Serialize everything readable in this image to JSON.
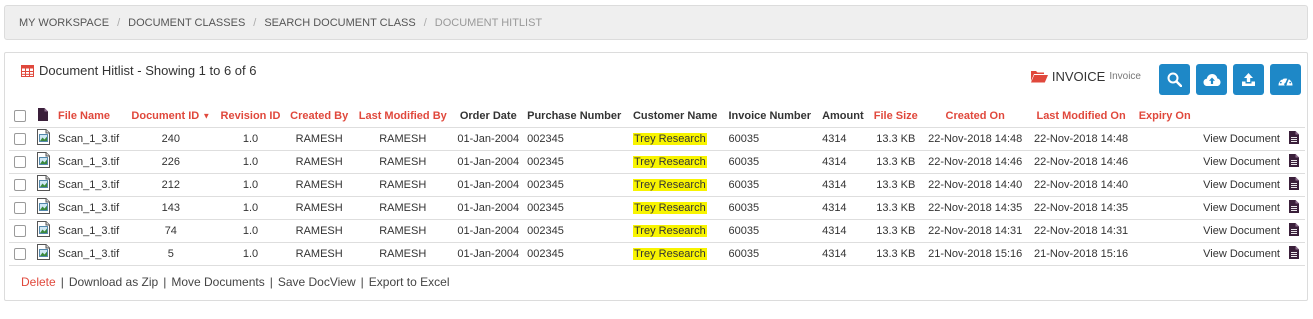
{
  "breadcrumb": [
    "MY WORKSPACE",
    "DOCUMENT CLASSES",
    "SEARCH DOCUMENT CLASS",
    "DOCUMENT HITLIST"
  ],
  "panel": {
    "title": "Document Hitlist - Showing 1 to 6 of 6",
    "title_icon": "table-icon",
    "doc_class": "INVOICE",
    "doc_class_sub": "Invoice",
    "doc_class_icon": "folder-open-icon",
    "toolbar_icons": [
      "search-icon",
      "cloud-upload-icon",
      "upload-icon",
      "dashboard-icon"
    ]
  },
  "columns": [
    "File Name",
    "Document ID",
    "Revision ID",
    "Created By",
    "Last Modified By",
    "Order Date",
    "Purchase Number",
    "Customer Name",
    "Invoice Number",
    "Amount",
    "File Size",
    "Created On",
    "Last Modified On",
    "Expiry On"
  ],
  "sortable_columns": [
    "File Name",
    "Document ID",
    "Revision ID",
    "Created By",
    "Last Modified By",
    "File Size",
    "Created On",
    "Last Modified On",
    "Expiry On"
  ],
  "sorted_column": "Document ID",
  "rows": [
    {
      "file": "Scan_1_3.tif",
      "doc_id": "240",
      "rev": "1.0",
      "created_by": "RAMESH",
      "modified_by": "RAMESH",
      "order_date": "01-Jan-2004",
      "purchase": "002345",
      "customer": "Trey Research",
      "invoice": "60035",
      "amount": "4314",
      "size": "13.3 KB",
      "created_on": "22-Nov-2018 14:48",
      "modified_on": "22-Nov-2018 14:48",
      "expiry": "",
      "action": "View Document"
    },
    {
      "file": "Scan_1_3.tif",
      "doc_id": "226",
      "rev": "1.0",
      "created_by": "RAMESH",
      "modified_by": "RAMESH",
      "order_date": "01-Jan-2004",
      "purchase": "002345",
      "customer": "Trey Research",
      "invoice": "60035",
      "amount": "4314",
      "size": "13.3 KB",
      "created_on": "22-Nov-2018 14:46",
      "modified_on": "22-Nov-2018 14:46",
      "expiry": "",
      "action": "View Document"
    },
    {
      "file": "Scan_1_3.tif",
      "doc_id": "212",
      "rev": "1.0",
      "created_by": "RAMESH",
      "modified_by": "RAMESH",
      "order_date": "01-Jan-2004",
      "purchase": "002345",
      "customer": "Trey Research",
      "invoice": "60035",
      "amount": "4314",
      "size": "13.3 KB",
      "created_on": "22-Nov-2018 14:40",
      "modified_on": "22-Nov-2018 14:40",
      "expiry": "",
      "action": "View Document"
    },
    {
      "file": "Scan_1_3.tif",
      "doc_id": "143",
      "rev": "1.0",
      "created_by": "RAMESH",
      "modified_by": "RAMESH",
      "order_date": "01-Jan-2004",
      "purchase": "002345",
      "customer": "Trey Research",
      "invoice": "60035",
      "amount": "4314",
      "size": "13.3 KB",
      "created_on": "22-Nov-2018 14:35",
      "modified_on": "22-Nov-2018 14:35",
      "expiry": "",
      "action": "View Document"
    },
    {
      "file": "Scan_1_3.tif",
      "doc_id": "74",
      "rev": "1.0",
      "created_by": "RAMESH",
      "modified_by": "RAMESH",
      "order_date": "01-Jan-2004",
      "purchase": "002345",
      "customer": "Trey Research",
      "invoice": "60035",
      "amount": "4314",
      "size": "13.3 KB",
      "created_on": "22-Nov-2018 14:31",
      "modified_on": "22-Nov-2018 14:31",
      "expiry": "",
      "action": "View Document"
    },
    {
      "file": "Scan_1_3.tif",
      "doc_id": "5",
      "rev": "1.0",
      "created_by": "RAMESH",
      "modified_by": "RAMESH",
      "order_date": "01-Jan-2004",
      "purchase": "002345",
      "customer": "Trey Research",
      "invoice": "60035",
      "amount": "4314",
      "size": "13.3 KB",
      "created_on": "21-Nov-2018 15:16",
      "modified_on": "21-Nov-2018 15:16",
      "expiry": "",
      "action": "View Document"
    }
  ],
  "footer_actions": [
    "Delete",
    "Download as Zip",
    "Move Documents",
    "Save DocView",
    "Export to Excel"
  ],
  "colors": {
    "accent": "#1e88c7",
    "sort_header": "#e0483c",
    "highlight": "#f8f400",
    "danger": "#e0483c"
  }
}
